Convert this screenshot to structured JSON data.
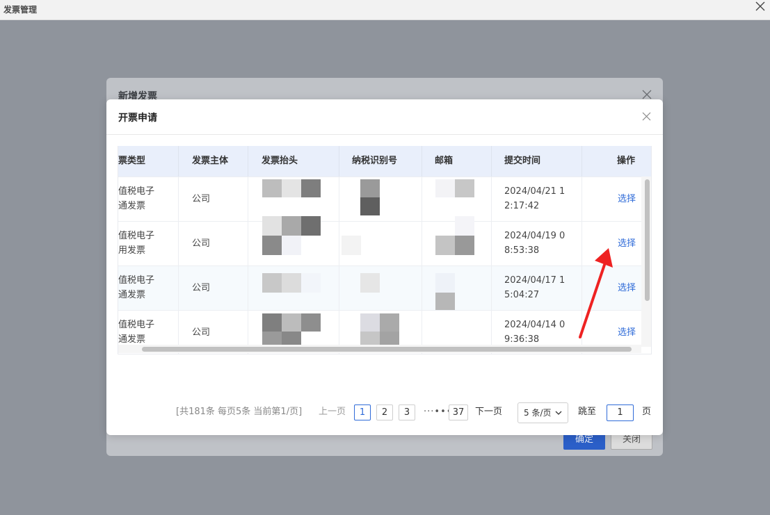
{
  "app": {
    "window_title": "发票管理"
  },
  "back_dialog": {
    "title": "新增发票",
    "confirm_label": "确定",
    "close_label": "关闭"
  },
  "dialog": {
    "title": "开票申请"
  },
  "table": {
    "headers": [
      "票类型",
      "发票主体",
      "发票抬头",
      "纳税识别号",
      "邮箱",
      "提交时间",
      "操作"
    ],
    "rows": [
      {
        "type_line1": "值税电子",
        "type_line2": "通发票",
        "entity": "公司",
        "time_line1": "2024/04/21 1",
        "time_line2": "2:17:42",
        "action": "选择"
      },
      {
        "type_line1": "值税电子",
        "type_line2": "用发票",
        "entity": "公司",
        "time_line1": "2024/04/19 0",
        "time_line2": "8:53:38",
        "action": "选择"
      },
      {
        "type_line1": "值税电子",
        "type_line2": "通发票",
        "entity": "公司",
        "time_line1": "2024/04/17 1",
        "time_line2": "5:04:27",
        "action": "选择"
      },
      {
        "type_line1": "值税电子",
        "type_line2": "通发票",
        "entity": "公司",
        "time_line1": "2024/04/14 0",
        "time_line2": "9:36:38",
        "action": "选择"
      }
    ]
  },
  "pagination": {
    "summary": "[共181条 每页5条 当前第1/页]",
    "prev_label": "上一页",
    "pages": [
      "1",
      "2",
      "3"
    ],
    "ellipsis": "···•••",
    "last_page": "37",
    "next_label": "下一页",
    "page_size": "5 条/页",
    "goto_label": "跳至",
    "goto_value": "1",
    "page_unit": "页"
  },
  "colors": {
    "accent": "#2f6bd8",
    "annotation_arrow": "#ee2222",
    "header_bg": "#e9effb"
  },
  "icons": {
    "close": "close-icon",
    "chevron": "chevron-down-icon"
  }
}
